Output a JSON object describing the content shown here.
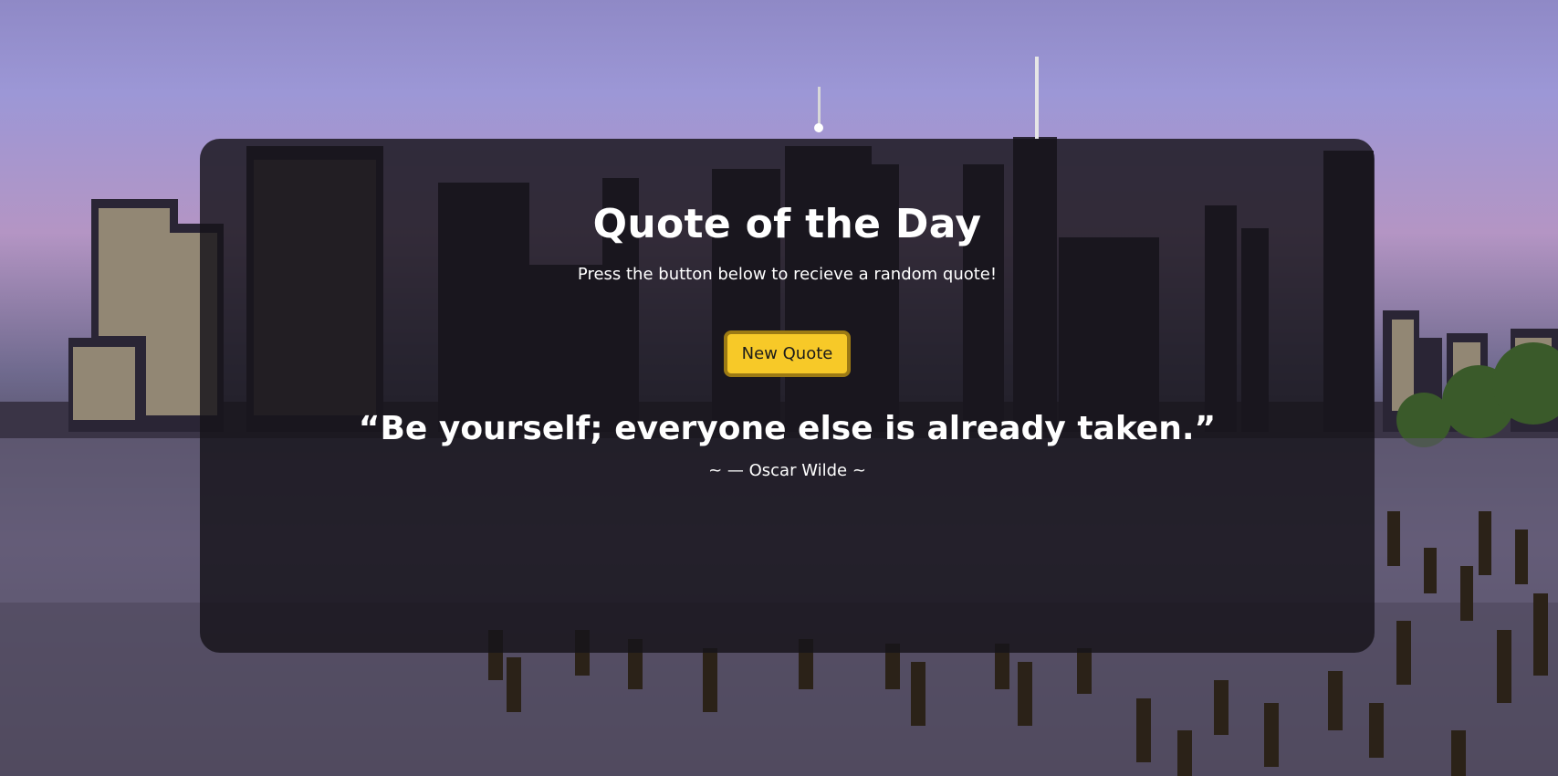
{
  "page": {
    "title": "Quote of the Day",
    "subtitle": "Press the button below to recieve a random quote!",
    "button_label": "New Quote",
    "quote_text": "“Be yourself; everyone else is already taken.”",
    "quote_author": "~ — Oscar Wilde ~"
  },
  "colors": {
    "button_fill": "#f7c928",
    "button_border": "#9c7a14",
    "card_background": "rgba(22,20,26,0.82)",
    "text": "#ffffff"
  },
  "background": {
    "description_icon": "city-skyline-image"
  }
}
